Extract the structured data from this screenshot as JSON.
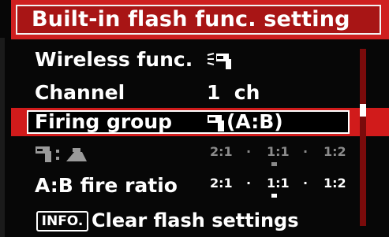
{
  "title": "Built-in flash func. setting",
  "menu": {
    "wireless": {
      "label": "Wireless func.",
      "icon": "wireless-flash-icon"
    },
    "channel": {
      "label": "Channel",
      "value": "1  ch"
    },
    "firing_group": {
      "label": "Firing group",
      "value": "(A:B)",
      "icon": "flash-unit-icon"
    },
    "builtin_ratio": {
      "icon": "builtin-flash-to-external-flash-icon",
      "separator": ":",
      "scale_left": "2:1",
      "scale_mid": "1:1",
      "scale_right": "1:2",
      "dot": "·",
      "selected": "1:1"
    },
    "ab_ratio": {
      "label": "A:B fire ratio",
      "scale_left": "2:1",
      "scale_mid": "1:1",
      "scale_right": "1:2",
      "dot": "·",
      "selected": "1:1"
    }
  },
  "footer": {
    "info_button": "INFO.",
    "text": "Clear flash settings"
  },
  "colors": {
    "accent_red": "#d11b1b",
    "title_red": "#a81515",
    "dim_gray": "#8a8a8a"
  }
}
